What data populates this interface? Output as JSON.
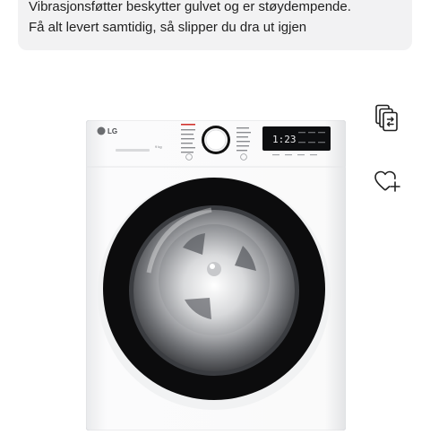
{
  "description": {
    "lines": [
      "Vibrasjonsføtter beskytter gulvet og er støydempende.",
      "Få alt levert samtidig, så slipper du dra ut igjen"
    ]
  },
  "product": {
    "brand_logo_text": "LG",
    "capacity_label": "9 kg",
    "display_time": "1:23",
    "alt": "LG vaskemaskin hvit med svart dør"
  },
  "actions": {
    "compare_icon": "compare-icon",
    "favorite_icon": "heart-plus-icon"
  },
  "colors": {
    "description_bg": "#f2f2f3",
    "machine_body": "#ffffff",
    "door_ring": "#111111"
  }
}
